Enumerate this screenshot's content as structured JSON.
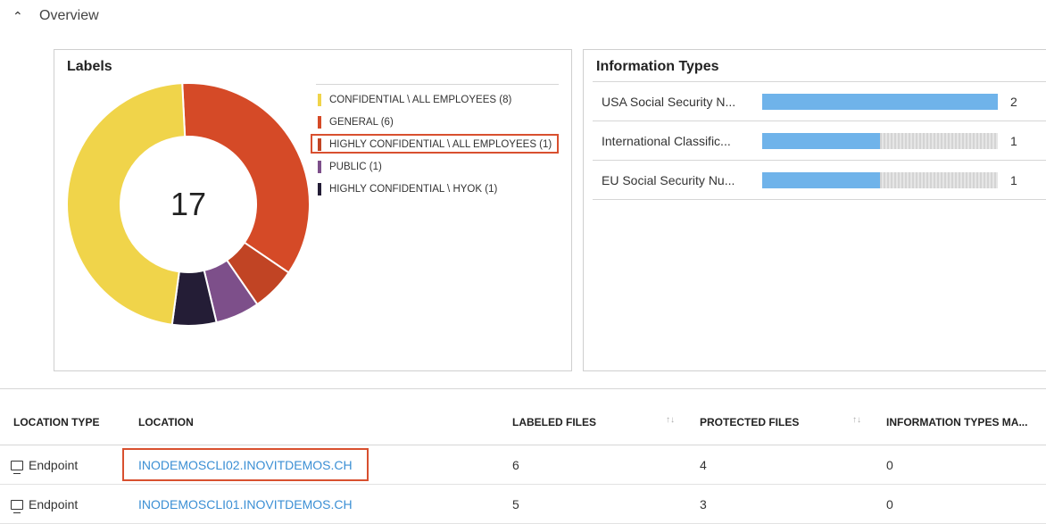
{
  "overview": {
    "title": "Overview"
  },
  "labels_card": {
    "title": "Labels",
    "total": "17",
    "items": [
      {
        "label": "CONFIDENTIAL \\ ALL EMPLOYEES (8)",
        "value": 8,
        "color": "#f0d44a"
      },
      {
        "label": "GENERAL (6)",
        "value": 6,
        "color": "#d54a27"
      },
      {
        "label": "HIGHLY CONFIDENTIAL \\ ALL EMPLOYEES (1)",
        "value": 1,
        "color": "#c14424"
      },
      {
        "label": "PUBLIC (1)",
        "value": 1,
        "color": "#7d4f8a"
      },
      {
        "label": "HIGHLY CONFIDENTIAL \\ HYOK (1)",
        "value": 1,
        "color": "#241d36"
      }
    ]
  },
  "info_card": {
    "title": "Information Types",
    "rows": [
      {
        "name": "USA Social Security N...",
        "count": "2",
        "fraction": 1.0
      },
      {
        "name": "International Classific...",
        "count": "1",
        "fraction": 0.5
      },
      {
        "name": "EU Social Security Nu...",
        "count": "1",
        "fraction": 0.5
      }
    ]
  },
  "table": {
    "columns": [
      "LOCATION TYPE",
      "LOCATION",
      "LABELED FILES",
      "PROTECTED FILES",
      "INFORMATION TYPES MA..."
    ],
    "sort_icon": "↑↓",
    "rows": [
      {
        "type": "Endpoint",
        "location": "INODEMOSCLI02.INOVITDEMOS.CH",
        "labeled": "6",
        "protected": "4",
        "info": "0"
      },
      {
        "type": "Endpoint",
        "location": "INODEMOSCLI01.INOVITDEMOS.CH",
        "labeled": "5",
        "protected": "3",
        "info": "0"
      }
    ]
  }
}
